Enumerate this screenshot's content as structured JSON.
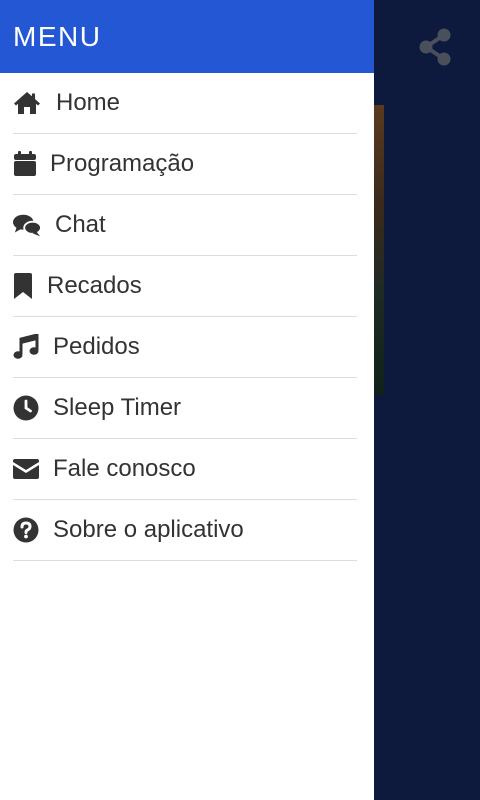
{
  "header": {
    "title": "MENU",
    "background": "#2457d4"
  },
  "menu": {
    "items": [
      {
        "label": "Home",
        "icon": "home-icon"
      },
      {
        "label": "Programação",
        "icon": "calendar-icon"
      },
      {
        "label": "Chat",
        "icon": "chat-bubbles-icon"
      },
      {
        "label": "Recados",
        "icon": "bookmark-icon"
      },
      {
        "label": "Pedidos",
        "icon": "music-note-icon"
      },
      {
        "label": "Sleep Timer",
        "icon": "clock-icon"
      },
      {
        "label": "Fale conosco",
        "icon": "envelope-icon"
      },
      {
        "label": "Sobre o aplicativo",
        "icon": "question-circle-icon"
      }
    ]
  },
  "topbar": {
    "share_icon": "share-icon"
  },
  "colors": {
    "app_background": "#0e1a3d",
    "drawer_background": "#ffffff",
    "text": "#333333",
    "divider": "#dcdcdc"
  }
}
